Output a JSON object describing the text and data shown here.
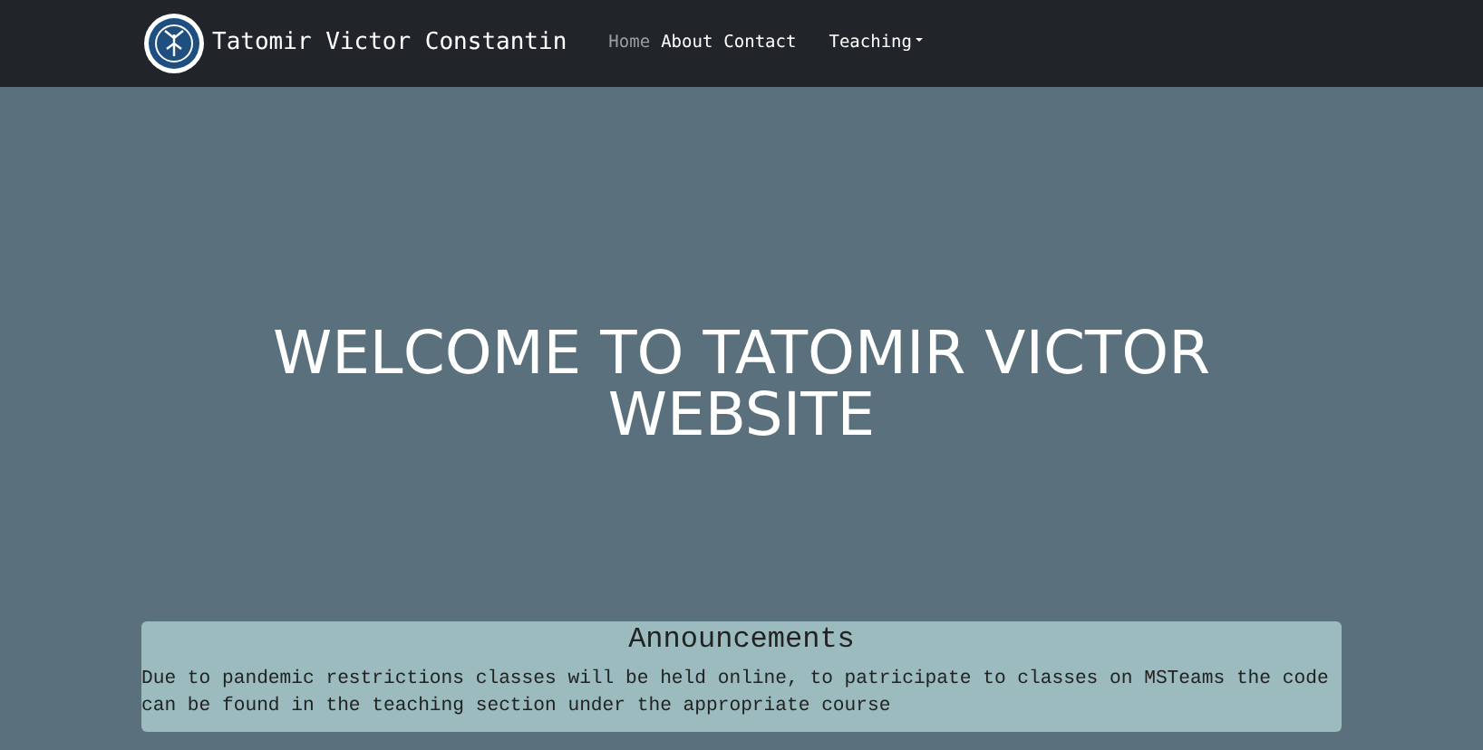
{
  "navbar": {
    "brand": "Tatomir Victor Constantin",
    "links": [
      {
        "label": "Home",
        "selected": true
      },
      {
        "label": "About",
        "selected": false
      },
      {
        "label": "Contact",
        "selected": false
      }
    ],
    "dropdown": {
      "label": "Teaching"
    }
  },
  "hero": {
    "title": "WELCOME TO TATOMIR VICTOR WEBSITE"
  },
  "announcements": {
    "title": "Announcements",
    "text": "Due to pandemic restrictions classes will be held online, to patricipate to classes on MSTeams the code can be found in the teaching section under the appropriate course"
  }
}
